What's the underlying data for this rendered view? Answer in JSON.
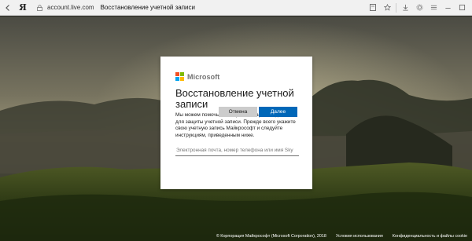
{
  "browser": {
    "logo": "Я",
    "host": "account.live.com",
    "tab_title": "Восстановление учетной записи",
    "icons": [
      "back-icon",
      "yandex-logo",
      "lock-icon",
      "bookmarks-icon",
      "download-icon",
      "settings-icon",
      "minimize-icon",
      "maximize-icon",
      "star-icon"
    ]
  },
  "dialog": {
    "brand": "Microsoft",
    "brand_colors": [
      "#f25022",
      "#7fba00",
      "#00a4ef",
      "#ffb900"
    ],
    "title": "Восстановление учетной записи",
    "description": "Мы можем помочь вам сбросить пароль и данные для защиты учетной записи. Прежде всего укажите свою учетную запись Майкрософт и следуйте инструкциям, приведенным ниже.",
    "input_placeholder": "Электронная почта, номер телефона или имя Sky",
    "input_value": "",
    "cancel_label": "Отмена",
    "next_label": "Далее",
    "accent_color": "#0067b8"
  },
  "footer": {
    "copyright": "© Корпорация Майкрософт (Microsoft Corporation), 2018",
    "terms": "Условия использования",
    "privacy": "Конфиденциальность и файлы cookie"
  }
}
